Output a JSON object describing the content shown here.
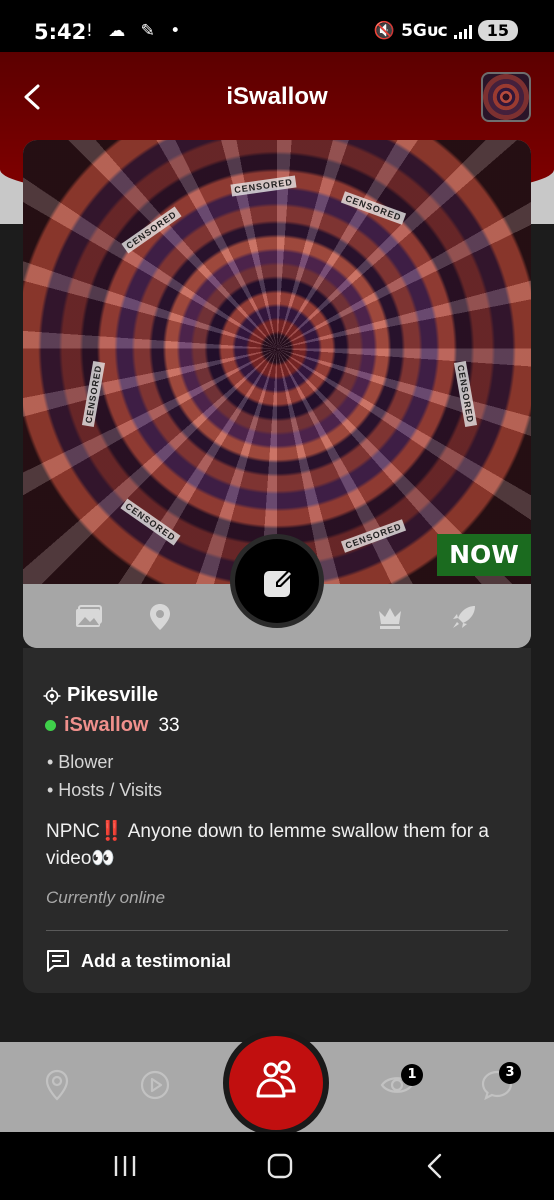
{
  "status_bar": {
    "time": "5:42",
    "left_icons": "! ☁ ✎ •",
    "network": "5Gᴜᴄ",
    "battery": "15"
  },
  "header": {
    "title": "iSwallow"
  },
  "photo": {
    "watermark": "CENSORED",
    "badge": "NOW"
  },
  "profile": {
    "location": "Pikesville",
    "name": "iSwallow",
    "age": "33",
    "tags": [
      "• Blower",
      "• Hosts / Visits"
    ],
    "bio": "NPNC‼️ Anyone down to lemme swallow them for a video👀",
    "status_note": "Currently online",
    "testimonial_label": "Add a testimonial"
  },
  "bottom_nav": {
    "views_badge": "1",
    "messages_badge": "3"
  },
  "colors": {
    "header_red": "#830000",
    "fab_red": "#c10f0f",
    "now_green": "#1b6b1f",
    "online_green": "#3fd04a",
    "name_pink": "#f0908c"
  },
  "icons": [
    "back-arrow-icon",
    "avatar-thumbnail",
    "edit-icon",
    "gallery-icon",
    "location-pin-icon",
    "crown-icon",
    "rocket-icon",
    "target-location-icon",
    "chat-bubble-icon",
    "map-pin-icon",
    "play-icon",
    "people-icon",
    "eye-icon",
    "message-icon"
  ]
}
